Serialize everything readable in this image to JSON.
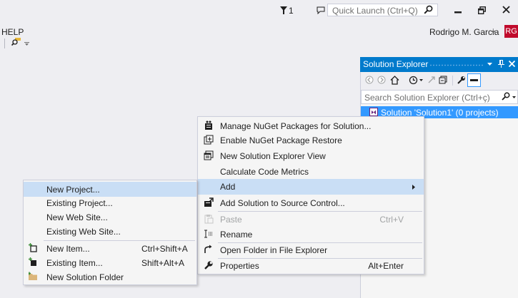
{
  "titlebar": {
    "notifications_count": "1",
    "quick_launch_placeholder": "Quick Launch (Ctrl+Q)"
  },
  "menu": {
    "help": "HELP"
  },
  "account": {
    "name": "Rodrigo M. Garcia",
    "initials": "RG",
    "avatar_color": "#c00a2c"
  },
  "solution_explorer": {
    "title": "Solution Explorer",
    "search_placeholder": "Search Solution Explorer (Ctrl+ç)",
    "tree": [
      {
        "label": "Solution 'Solution1' (0 projects)",
        "selected": true
      }
    ],
    "header_color": "#007acc"
  },
  "context_menu": {
    "items": [
      {
        "label": "Manage NuGet Packages for Solution...",
        "icon": "nuget-icon"
      },
      {
        "label": "Enable NuGet Package Restore",
        "icon": "package-restore-icon"
      },
      {
        "label": "New Solution Explorer View",
        "icon": "new-view-icon"
      },
      {
        "label": "Calculate Code Metrics"
      },
      {
        "label": "Add",
        "highlighted": true,
        "submenu": true
      },
      {
        "label": "Add Solution to Source Control...",
        "icon": "source-control-icon"
      },
      {
        "label": "Paste",
        "shortcut": "Ctrl+V",
        "disabled": true,
        "icon": "paste-icon"
      },
      {
        "label": "Rename",
        "icon": "rename-icon"
      },
      {
        "label": "Open Folder in File Explorer",
        "icon": "open-folder-icon"
      },
      {
        "label": "Properties",
        "shortcut": "Alt+Enter",
        "icon": "wrench-icon"
      }
    ]
  },
  "add_submenu": {
    "items": [
      {
        "label": "New Project...",
        "highlighted": true
      },
      {
        "label": "Existing Project..."
      },
      {
        "label": "New Web Site..."
      },
      {
        "label": "Existing Web Site..."
      },
      {
        "label": "New Item...",
        "shortcut": "Ctrl+Shift+A",
        "icon": "new-item-icon"
      },
      {
        "label": "Existing Item...",
        "shortcut": "Shift+Alt+A",
        "icon": "existing-item-icon"
      },
      {
        "label": "New Solution Folder",
        "icon": "solution-folder-icon"
      }
    ]
  },
  "colors": {
    "highlight": "#c9def5",
    "selection": "#3399ff",
    "accent": "#007acc"
  }
}
